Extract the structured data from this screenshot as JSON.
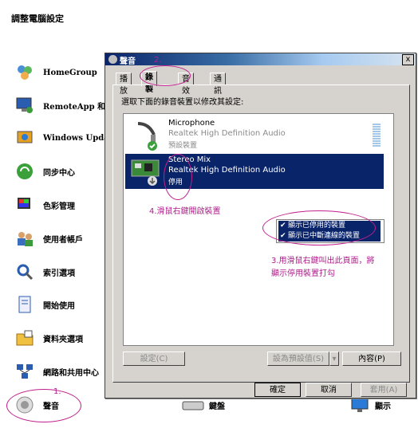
{
  "background": {
    "title": "調整電腦設定",
    "items": [
      {
        "label": "HomeGroup",
        "icon": "homegroup-icon"
      },
      {
        "label": "RemoteApp 和桌",
        "icon": "remoteapp-icon"
      },
      {
        "label": "Windows Updat",
        "icon": "windows-update-icon"
      },
      {
        "label": "同步中心",
        "icon": "sync-center-icon"
      },
      {
        "label": "色彩管理",
        "icon": "color-management-icon"
      },
      {
        "label": "使用者帳戶",
        "icon": "user-accounts-icon"
      },
      {
        "label": "索引選項",
        "icon": "indexing-icon"
      },
      {
        "label": "開始使用",
        "icon": "getting-started-icon"
      },
      {
        "label": "資料夾選項",
        "icon": "folder-options-icon"
      },
      {
        "label": "網路和共用中心",
        "icon": "network-icon"
      },
      {
        "label": "聲音",
        "icon": "sound-icon"
      }
    ],
    "bottom_labels": {
      "keyboard": "鍵盤",
      "display": "顯示"
    }
  },
  "dialog": {
    "title": "聲音",
    "close": "x",
    "tabs": [
      "播放",
      "錄製",
      "音效",
      "通訊"
    ],
    "active_tab": "錄製",
    "instruction": "選取下面的錄音裝置以修改其設定:",
    "devices": [
      {
        "name": "Microphone",
        "driver": "Realtek High Definition Audio",
        "status": "預設裝置"
      },
      {
        "name": "Stereo Mix",
        "driver": "Realtek High Definition Audio",
        "status": "停用"
      }
    ],
    "context_menu": [
      {
        "label": "顯示已停用的裝置",
        "checked": "✔"
      },
      {
        "label": "顯示已中斷連線的裝置",
        "checked": "✔"
      }
    ],
    "buttons": {
      "configure": "設定(C)",
      "set_default": "設為預設值(S)",
      "properties": "內容(P)",
      "ok": "確定",
      "cancel": "取消",
      "apply": "套用(A)"
    }
  },
  "annotations": {
    "step1": "1.",
    "step2": "2.",
    "step3": "3.用滑鼠右鍵叫出此頁面，將\n顯示停用裝置打勾",
    "step4": "4.滑鼠右鍵開啟裝置"
  }
}
